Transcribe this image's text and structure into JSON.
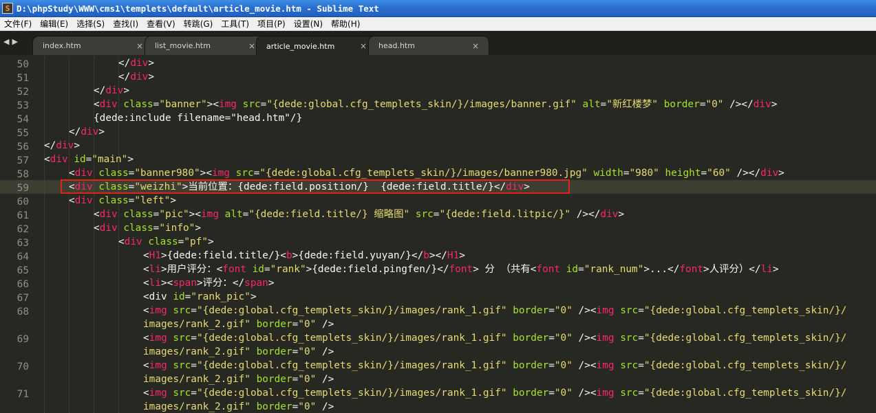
{
  "window": {
    "title": "D:\\phpStudy\\WWW\\cms1\\templets\\default\\article_movie.htm - Sublime Text",
    "icon": "sublime-text-icon"
  },
  "menu": [
    "文件(F)",
    "编辑(E)",
    "选择(S)",
    "查找(I)",
    "查看(V)",
    "转跳(G)",
    "工具(T)",
    "项目(P)",
    "设置(N)",
    "帮助(H)"
  ],
  "tabs": [
    {
      "label": "index.htm",
      "active": false
    },
    {
      "label": "list_movie.htm",
      "active": false
    },
    {
      "label": "article_movie.htm",
      "active": true
    },
    {
      "label": "head.htm",
      "active": false
    }
  ],
  "colors": {
    "background": "#272822",
    "tag": "#f92672",
    "attribute": "#a6e22e",
    "string": "#e6db74",
    "text": "#f8f8f2",
    "highlight_box": "#e2231a"
  },
  "editor": {
    "current_line": "59",
    "highlighted_line": "59",
    "lines": [
      {
        "num": "50",
        "indent": 3,
        "tokens": [
          [
            "p",
            "</"
          ],
          [
            "t",
            "div"
          ],
          [
            "p",
            ">"
          ]
        ]
      },
      {
        "num": "51",
        "indent": 3,
        "tokens": [
          [
            "p",
            "</"
          ],
          [
            "t",
            "div"
          ],
          [
            "p",
            ">"
          ]
        ]
      },
      {
        "num": "52",
        "indent": 2,
        "tokens": [
          [
            "p",
            "</"
          ],
          [
            "t",
            "div"
          ],
          [
            "p",
            ">"
          ]
        ]
      },
      {
        "num": "53",
        "indent": 2,
        "tokens": [
          [
            "p",
            "<"
          ],
          [
            "t",
            "div"
          ],
          [
            "p",
            " "
          ],
          [
            "a",
            "class"
          ],
          [
            "p",
            "="
          ],
          [
            "s",
            "\"banner\""
          ],
          [
            "p",
            "><"
          ],
          [
            "t",
            "img"
          ],
          [
            "p",
            " "
          ],
          [
            "a",
            "src"
          ],
          [
            "p",
            "="
          ],
          [
            "s",
            "\"{dede:global.cfg_templets_skin/}/images/banner.gif\""
          ],
          [
            "p",
            " "
          ],
          [
            "a",
            "alt"
          ],
          [
            "p",
            "="
          ],
          [
            "s",
            "\"新红楼梦\""
          ],
          [
            "p",
            " "
          ],
          [
            "a",
            "border"
          ],
          [
            "p",
            "="
          ],
          [
            "s",
            "\"0\""
          ],
          [
            "p",
            " /></"
          ],
          [
            "t",
            "div"
          ],
          [
            "p",
            ">"
          ]
        ]
      },
      {
        "num": "54",
        "indent": 2,
        "tokens": [
          [
            "p",
            "{dede:include filename=\"head.htm\"/}"
          ]
        ]
      },
      {
        "num": "55",
        "indent": 1,
        "tokens": [
          [
            "p",
            "</"
          ],
          [
            "t",
            "div"
          ],
          [
            "p",
            ">"
          ]
        ]
      },
      {
        "num": "56",
        "indent": 0,
        "tokens": [
          [
            "p",
            "</"
          ],
          [
            "t",
            "div"
          ],
          [
            "p",
            ">"
          ]
        ]
      },
      {
        "num": "57",
        "indent": 0,
        "tokens": [
          [
            "p",
            "<"
          ],
          [
            "t",
            "div"
          ],
          [
            "p",
            " "
          ],
          [
            "a",
            "id"
          ],
          [
            "p",
            "="
          ],
          [
            "s",
            "\"main\""
          ],
          [
            "p",
            ">"
          ]
        ]
      },
      {
        "num": "58",
        "indent": 1,
        "tokens": [
          [
            "p",
            "<"
          ],
          [
            "t",
            "div"
          ],
          [
            "p",
            " "
          ],
          [
            "a",
            "class"
          ],
          [
            "p",
            "="
          ],
          [
            "s",
            "\"banner980\""
          ],
          [
            "p",
            "><"
          ],
          [
            "t",
            "img"
          ],
          [
            "p",
            " "
          ],
          [
            "a",
            "src"
          ],
          [
            "p",
            "="
          ],
          [
            "s",
            "\"{dede:global.cfg_templets_skin/}/images/banner980.jpg\""
          ],
          [
            "p",
            " "
          ],
          [
            "a",
            "width"
          ],
          [
            "p",
            "="
          ],
          [
            "s",
            "\"980\""
          ],
          [
            "p",
            " "
          ],
          [
            "a",
            "height"
          ],
          [
            "p",
            "="
          ],
          [
            "s",
            "\"60\""
          ],
          [
            "p",
            " /></"
          ],
          [
            "t",
            "div"
          ],
          [
            "p",
            ">"
          ]
        ]
      },
      {
        "num": "59",
        "indent": 1,
        "tokens": [
          [
            "p",
            "<"
          ],
          [
            "t",
            "div"
          ],
          [
            "p",
            " "
          ],
          [
            "a",
            "class"
          ],
          [
            "p",
            "="
          ],
          [
            "s",
            "\"weizhi\""
          ],
          [
            "p",
            ">当前位置：{dede:field.position/}  {dede:field.title/}</"
          ],
          [
            "t",
            "div"
          ],
          [
            "p",
            ">"
          ]
        ]
      },
      {
        "num": "60",
        "indent": 1,
        "tokens": [
          [
            "p",
            "<"
          ],
          [
            "t",
            "div"
          ],
          [
            "p",
            " "
          ],
          [
            "a",
            "class"
          ],
          [
            "p",
            "="
          ],
          [
            "s",
            "\"left\""
          ],
          [
            "p",
            ">"
          ]
        ]
      },
      {
        "num": "61",
        "indent": 2,
        "tokens": [
          [
            "p",
            "<"
          ],
          [
            "t",
            "div"
          ],
          [
            "p",
            " "
          ],
          [
            "a",
            "class"
          ],
          [
            "p",
            "="
          ],
          [
            "s",
            "\"pic\""
          ],
          [
            "p",
            "><"
          ],
          [
            "t",
            "img"
          ],
          [
            "p",
            " "
          ],
          [
            "a",
            "alt"
          ],
          [
            "p",
            "="
          ],
          [
            "s",
            "\"{dede:field.title/} 缩略图\""
          ],
          [
            "p",
            " "
          ],
          [
            "a",
            "src"
          ],
          [
            "p",
            "="
          ],
          [
            "s",
            "\"{dede:field.litpic/}\""
          ],
          [
            "p",
            " /></"
          ],
          [
            "t",
            "div"
          ],
          [
            "p",
            ">"
          ]
        ]
      },
      {
        "num": "62",
        "indent": 2,
        "tokens": [
          [
            "p",
            "<"
          ],
          [
            "t",
            "div"
          ],
          [
            "p",
            " "
          ],
          [
            "a",
            "class"
          ],
          [
            "p",
            "="
          ],
          [
            "s",
            "\"info\""
          ],
          [
            "p",
            ">"
          ]
        ]
      },
      {
        "num": "63",
        "indent": 3,
        "tokens": [
          [
            "p",
            "<"
          ],
          [
            "t",
            "div"
          ],
          [
            "p",
            " "
          ],
          [
            "a",
            "class"
          ],
          [
            "p",
            "="
          ],
          [
            "s",
            "\"pf\""
          ],
          [
            "p",
            ">"
          ]
        ]
      },
      {
        "num": "64",
        "indent": 4,
        "tokens": [
          [
            "p",
            "<"
          ],
          [
            "t",
            "H1"
          ],
          [
            "p",
            ">{dede:field.title/}<"
          ],
          [
            "t",
            "b"
          ],
          [
            "p",
            ">{dede:field.yuyan/}</"
          ],
          [
            "t",
            "b"
          ],
          [
            "p",
            "></"
          ],
          [
            "t",
            "H1"
          ],
          [
            "p",
            ">"
          ]
        ]
      },
      {
        "num": "65",
        "indent": 4,
        "tokens": [
          [
            "p",
            "<"
          ],
          [
            "t",
            "li"
          ],
          [
            "p",
            ">用户评分：<"
          ],
          [
            "t",
            "font"
          ],
          [
            "p",
            " "
          ],
          [
            "a",
            "id"
          ],
          [
            "p",
            "="
          ],
          [
            "s",
            "\"rank\""
          ],
          [
            "p",
            ">{dede:field.pingfen/}</"
          ],
          [
            "t",
            "font"
          ],
          [
            "p",
            "> 分 （共有<"
          ],
          [
            "t",
            "font"
          ],
          [
            "p",
            " "
          ],
          [
            "a",
            "id"
          ],
          [
            "p",
            "="
          ],
          [
            "s",
            "\"rank_num\""
          ],
          [
            "p",
            ">...</"
          ],
          [
            "t",
            "font"
          ],
          [
            "p",
            ">人评分）</"
          ],
          [
            "t",
            "li"
          ],
          [
            "p",
            ">"
          ]
        ]
      },
      {
        "num": "66",
        "indent": 4,
        "tokens": [
          [
            "p",
            "<"
          ],
          [
            "t",
            "li"
          ],
          [
            "p",
            "><"
          ],
          [
            "t",
            "span"
          ],
          [
            "p",
            ">评分：</"
          ],
          [
            "t",
            "span"
          ],
          [
            "p",
            ">"
          ]
        ]
      },
      {
        "num": "67",
        "indent": 4,
        "tokens": [
          [
            "p",
            "<div "
          ],
          [
            "a",
            "id"
          ],
          [
            "p",
            "="
          ],
          [
            "s",
            "\"rank_pic\""
          ],
          [
            "p",
            ">"
          ]
        ]
      },
      {
        "num": "68",
        "indent": 4,
        "tokens": [
          [
            "p",
            "<"
          ],
          [
            "t",
            "img"
          ],
          [
            "p",
            " "
          ],
          [
            "a",
            "src"
          ],
          [
            "p",
            "="
          ],
          [
            "s",
            "\"{dede:global.cfg_templets_skin/}/images/rank_1.gif\""
          ],
          [
            "p",
            " "
          ],
          [
            "a",
            "border"
          ],
          [
            "p",
            "="
          ],
          [
            "s",
            "\"0\""
          ],
          [
            "p",
            " /><"
          ],
          [
            "t",
            "img"
          ],
          [
            "p",
            " "
          ],
          [
            "a",
            "src"
          ],
          [
            "p",
            "="
          ],
          [
            "s",
            "\"{dede:global.cfg_templets_skin/}/"
          ]
        ]
      },
      {
        "num": "",
        "indent": 4,
        "tokens": [
          [
            "s",
            "images/rank_2.gif\""
          ],
          [
            "p",
            " "
          ],
          [
            "a",
            "border"
          ],
          [
            "p",
            "="
          ],
          [
            "s",
            "\"0\""
          ],
          [
            "p",
            " />"
          ]
        ]
      },
      {
        "num": "69",
        "indent": 4,
        "tokens": [
          [
            "p",
            "<"
          ],
          [
            "t",
            "img"
          ],
          [
            "p",
            " "
          ],
          [
            "a",
            "src"
          ],
          [
            "p",
            "="
          ],
          [
            "s",
            "\"{dede:global.cfg_templets_skin/}/images/rank_1.gif\""
          ],
          [
            "p",
            " "
          ],
          [
            "a",
            "border"
          ],
          [
            "p",
            "="
          ],
          [
            "s",
            "\"0\""
          ],
          [
            "p",
            " /><"
          ],
          [
            "t",
            "img"
          ],
          [
            "p",
            " "
          ],
          [
            "a",
            "src"
          ],
          [
            "p",
            "="
          ],
          [
            "s",
            "\"{dede:global.cfg_templets_skin/}/"
          ]
        ]
      },
      {
        "num": "",
        "indent": 4,
        "tokens": [
          [
            "s",
            "images/rank_2.gif\""
          ],
          [
            "p",
            " "
          ],
          [
            "a",
            "border"
          ],
          [
            "p",
            "="
          ],
          [
            "s",
            "\"0\""
          ],
          [
            "p",
            " />"
          ]
        ]
      },
      {
        "num": "70",
        "indent": 4,
        "tokens": [
          [
            "p",
            "<"
          ],
          [
            "t",
            "img"
          ],
          [
            "p",
            " "
          ],
          [
            "a",
            "src"
          ],
          [
            "p",
            "="
          ],
          [
            "s",
            "\"{dede:global.cfg_templets_skin/}/images/rank_1.gif\""
          ],
          [
            "p",
            " "
          ],
          [
            "a",
            "border"
          ],
          [
            "p",
            "="
          ],
          [
            "s",
            "\"0\""
          ],
          [
            "p",
            " /><"
          ],
          [
            "t",
            "img"
          ],
          [
            "p",
            " "
          ],
          [
            "a",
            "src"
          ],
          [
            "p",
            "="
          ],
          [
            "s",
            "\"{dede:global.cfg_templets_skin/}/"
          ]
        ]
      },
      {
        "num": "",
        "indent": 4,
        "tokens": [
          [
            "s",
            "images/rank_2.gif\""
          ],
          [
            "p",
            " "
          ],
          [
            "a",
            "border"
          ],
          [
            "p",
            "="
          ],
          [
            "s",
            "\"0\""
          ],
          [
            "p",
            " />"
          ]
        ]
      },
      {
        "num": "71",
        "indent": 4,
        "tokens": [
          [
            "p",
            "<"
          ],
          [
            "t",
            "img"
          ],
          [
            "p",
            " "
          ],
          [
            "a",
            "src"
          ],
          [
            "p",
            "="
          ],
          [
            "s",
            "\"{dede:global.cfg_templets_skin/}/images/rank_1.gif\""
          ],
          [
            "p",
            " "
          ],
          [
            "a",
            "border"
          ],
          [
            "p",
            "="
          ],
          [
            "s",
            "\"0\""
          ],
          [
            "p",
            " /><"
          ],
          [
            "t",
            "img"
          ],
          [
            "p",
            " "
          ],
          [
            "a",
            "src"
          ],
          [
            "p",
            "="
          ],
          [
            "s",
            "\"{dede:global.cfg_templets_skin/}/"
          ]
        ]
      },
      {
        "num": "",
        "indent": 4,
        "tokens": [
          [
            "s",
            "images/rank_2.gif\""
          ],
          [
            "p",
            " "
          ],
          [
            "a",
            "border"
          ],
          [
            "p",
            "="
          ],
          [
            "s",
            "\"0\""
          ],
          [
            "p",
            " />"
          ]
        ]
      }
    ]
  }
}
